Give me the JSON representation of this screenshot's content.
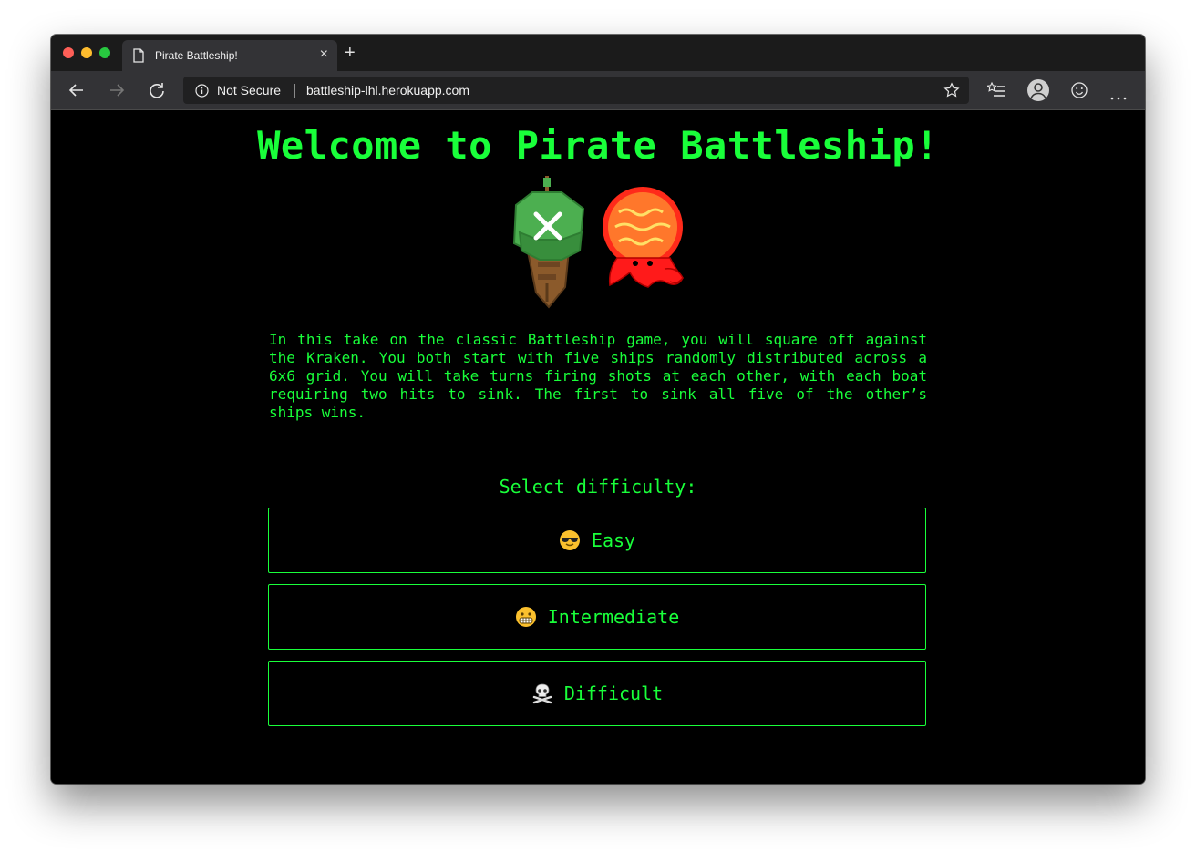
{
  "browser": {
    "tab_title": "Pirate Battleship!",
    "tab_close": "×",
    "new_tab": "+",
    "security_label": "Not Secure",
    "url": "battleship-lhl.herokuapp.com"
  },
  "page": {
    "title": "Welcome to Pirate Battleship!",
    "intro": "In this take on the classic Battleship game, you will square off against the Kraken. You both start with five ships randomly distributed across a 6x6 grid. You will take turns firing shots at each other, with each boat requiring two hits to sink. The first to sink all five of the other’s ships wins.",
    "select_label": "Select difficulty:",
    "difficulties": [
      {
        "label": "Easy",
        "icon": "sunglasses-face-emoji"
      },
      {
        "label": "Intermediate",
        "icon": "grimacing-face-emoji"
      },
      {
        "label": "Difficult",
        "icon": "skull-crossbones-emoji"
      }
    ]
  },
  "colors": {
    "accent_green": "#19ff3a",
    "page_background": "#000000",
    "kraken_red": "#ff1a1a",
    "ship_green": "#4caf50",
    "ship_wood": "#8b5a2b"
  }
}
